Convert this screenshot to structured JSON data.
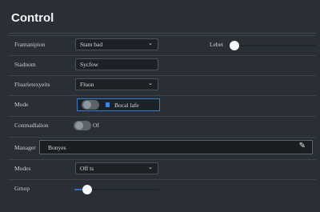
{
  "panel": {
    "title": "Control"
  },
  "rows": {
    "transmission": {
      "label": "Framanipion",
      "value": "Stam bad",
      "right_label": "Lebet",
      "slider_level": 0.05
    },
    "stadnom": {
      "label": "Stadnom",
      "value": "Sycfow"
    },
    "fluarie": {
      "label": "Fluarietexyeits",
      "value": "Fluon"
    },
    "mode": {
      "label": "Mode",
      "value": "Bocal lafe",
      "toggle_on": false
    },
    "connstation": {
      "label": "Conmadlalion",
      "toggle_label": "Of",
      "toggle_on": false
    },
    "manager": {
      "label": "Manager",
      "value": "Bonyes"
    },
    "modes": {
      "label": "Modes",
      "value": "Off ts"
    },
    "group": {
      "label": "Grnop",
      "slider_level": 0.15
    }
  },
  "colors": {
    "background": "#2a2f35",
    "accent": "#2e6fbf",
    "knob": "#f4f6f8"
  },
  "icons": {
    "dropdown": "chevron-down-icon",
    "edit": "pencil-icon"
  }
}
